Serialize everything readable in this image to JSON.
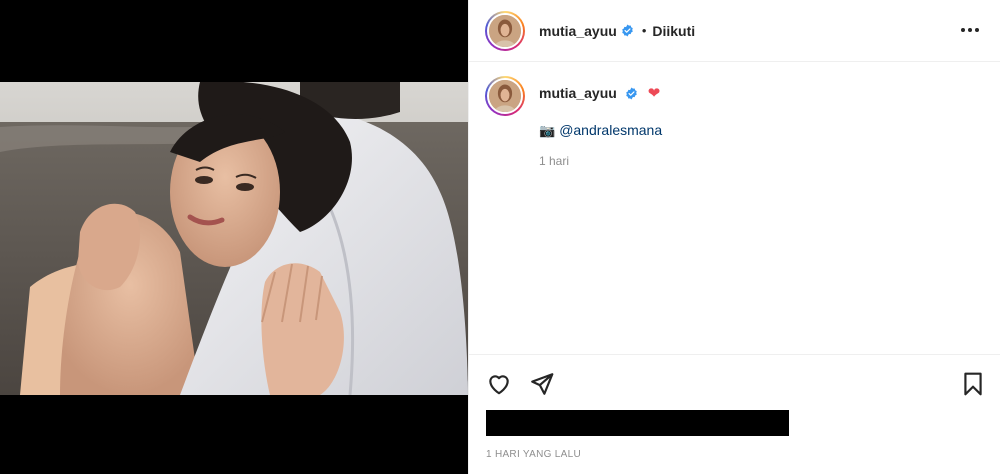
{
  "post": {
    "username": "mutia_ayuu",
    "dot": "•",
    "follow_status": "Diikuti",
    "verified_icon": "verified-badge-icon",
    "more_icon": "more-options-icon"
  },
  "caption": {
    "username": "mutia_ayuu",
    "heart": "❤",
    "camera_icon": "camera-icon",
    "camera_glyph": "📷",
    "mention": "@andralesmana",
    "time": "1 hari"
  },
  "actions": {
    "like_icon": "heart-outline-icon",
    "share_icon": "paper-plane-icon",
    "save_icon": "bookmark-icon"
  },
  "footer": {
    "time_ago": "1 HARI YANG LALU"
  },
  "colors": {
    "verified": "#3897f0",
    "heart": "#ed4956",
    "mention": "#00376b",
    "muted": "#8e8e8e"
  }
}
